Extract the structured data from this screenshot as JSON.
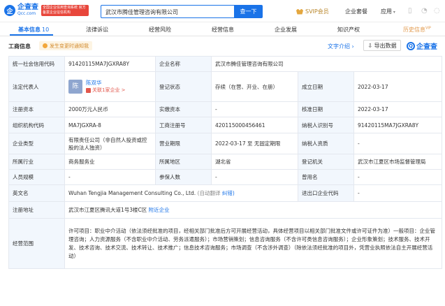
{
  "header": {
    "logo_mark": "企",
    "logo_name": "企查查",
    "logo_domain": "Qcc.com",
    "logo_badge": "全国企业信用查询系统 官方备案企业征信机构",
    "search_value": "武汉市腾佳管理咨询有限公司",
    "search_button": "查一下",
    "svip": "SVIP会员",
    "enterprise_pkg": "企业套餐",
    "apps": "应用"
  },
  "tabs": [
    {
      "label": "基本信息",
      "count": "10"
    },
    {
      "label": "法律诉讼"
    },
    {
      "label": "经营风险"
    },
    {
      "label": "经营信息"
    },
    {
      "label": "企业发展"
    },
    {
      "label": "知识产权"
    },
    {
      "label": "历史信息",
      "tag": "VIP"
    }
  ],
  "section": {
    "title": "工商信息",
    "notice": "发生变更时通知我",
    "text_intro": "文字介绍",
    "export": "导出数据",
    "brand": "企查查"
  },
  "info": {
    "credit_code_label": "统一社会信用代码",
    "credit_code": "91420115MA7JGXRA8Y",
    "company_name_label": "企业名称",
    "company_name": "武汉市腾佳管理咨询有限公司",
    "legal_rep_label": "法定代表人",
    "legal_rep_avatar": "陈",
    "legal_rep_name": "陈双华",
    "legal_rep_related": "关联1家企业 >",
    "reg_status_label": "登记状态",
    "reg_status": "存续（在营、开业、在册）",
    "founded_label": "成立日期",
    "founded": "2022-03-17",
    "reg_capital_label": "注册资本",
    "reg_capital": "2000万元人民币",
    "paid_capital_label": "实缴资本",
    "paid_capital": "-",
    "approved_label": "核准日期",
    "approved": "2022-03-17",
    "org_code_label": "组织机构代码",
    "org_code": "MA7JGXRA-8",
    "reg_no_label": "工商注册号",
    "reg_no": "420115000456461",
    "taxpayer_id_label": "纳税人识别号",
    "taxpayer_id": "91420115MA7JGXRA8Y",
    "type_label": "企业类型",
    "type": "有限责任公司（非自然人投资或控股的法人独资）",
    "term_label": "营业期限",
    "term": "2022-03-17 至 无固定期限",
    "taxpayer_qual_label": "纳税人资质",
    "taxpayer_qual": "-",
    "industry_label": "所属行业",
    "industry": "商务服务业",
    "region_label": "所属地区",
    "region": "湖北省",
    "authority_label": "登记机关",
    "authority": "武汉市江夏区市场监督管理局",
    "staff_label": "人员规模",
    "staff": "-",
    "insured_label": "参保人数",
    "insured": "-",
    "former_name_label": "曾用名",
    "former_name": "-",
    "english_label": "英文名",
    "english": "Wuhan Tengjia Management Consulting Co., Ltd.",
    "english_auto": "(自动翻译",
    "english_fix": "纠错)",
    "import_export_label": "进出口企业代码",
    "import_export": "-",
    "address_label": "注册地址",
    "address": "武汉市江夏区腾讯大道1号3楼C区",
    "address_nearby": "附近企业",
    "scope_label": "经营范围",
    "scope": "许可项目：职业中介活动（依法须经批准的项目，经相关部门批准后方可开展经营活动，具体经营项目以相关部门批准文件或许可证件为准）一般项目：企业管理咨询；人力资源服务（不含职业中介活动、劳务派遣服务）；市场营销策划；信息咨询服务（不含许可类信息咨询服务）；企业形象策划；技术服务、技术开发、技术咨询、技术交流、技术转让、技术推广；信息技术咨询服务；市场调查（不含涉外调查）（除依法须经批准的项目外，凭营业执照依法自主开展经营活动）"
  }
}
